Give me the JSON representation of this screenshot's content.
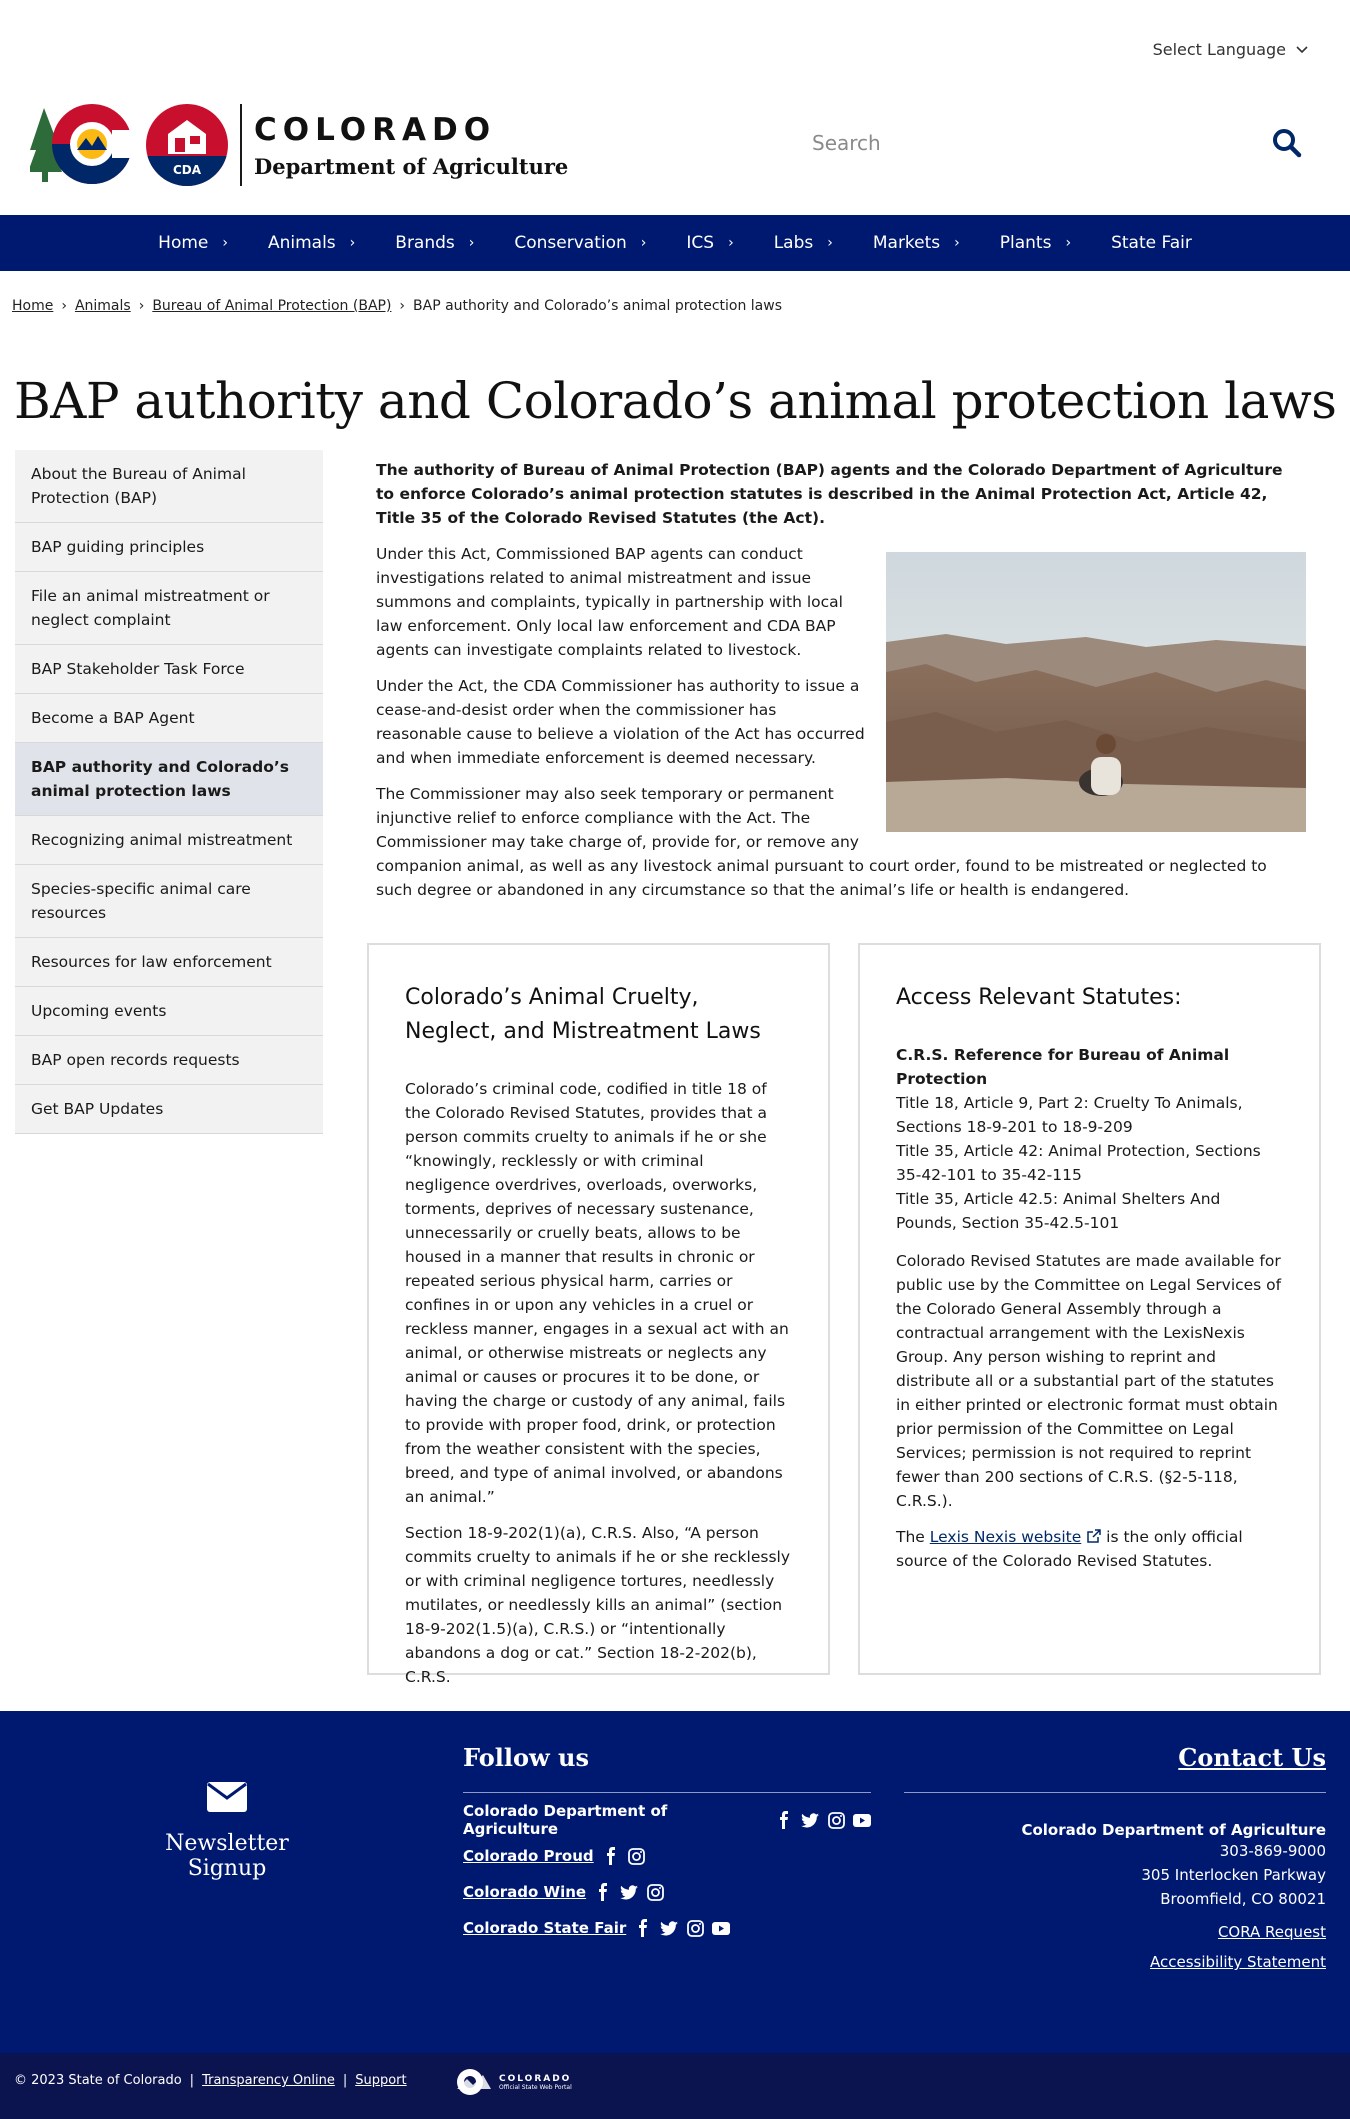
{
  "header": {
    "language": "Select Language",
    "logo_title": "COLORADO",
    "logo_subtitle": "Department of Agriculture",
    "logo_badge": "CDA",
    "search_placeholder": "Search"
  },
  "nav": [
    "Home",
    "Animals",
    "Brands",
    "Conservation",
    "ICS",
    "Labs",
    "Markets",
    "Plants",
    "State Fair"
  ],
  "breadcrumb": {
    "items": [
      "Home",
      "Animals",
      "Bureau of Animal Protection (BAP)"
    ],
    "current": "BAP authority and Colorado’s animal protection laws"
  },
  "page_title": "BAP authority and Colorado’s animal protection laws",
  "sidebar": {
    "items": [
      "About the Bureau of Animal Protection (BAP)",
      "BAP guiding principles",
      "File an animal mistreatment or neglect complaint",
      "BAP Stakeholder Task Force",
      "Become a BAP Agent",
      "BAP authority and Colorado’s animal protection laws",
      "Recognizing animal mistreatment",
      "Species-specific animal care resources",
      "Resources for law enforcement",
      "Upcoming events",
      "BAP open records requests",
      "Get BAP Updates"
    ],
    "active_index": 5
  },
  "main": {
    "intro": "The authority of Bureau of Animal Protection (BAP) agents and the Colorado Department of Agriculture to enforce Colorado’s animal protection statutes is described in the Animal Protection Act, Article 42, Title 35 of the Colorado Revised Statutes (the Act).",
    "p1": "Under this Act, Commissioned BAP agents can conduct investigations related to animal mistreatment and issue summons and complaints, typically in partnership with local law enforcement. Only local law enforcement and CDA BAP agents can investigate complaints related to livestock.",
    "p2": "Under the Act, the CDA Commissioner has authority to issue a cease-and-desist order when the commissioner has reasonable cause to believe a violation of the Act  has occurred and when immediate enforcement is deemed necessary.",
    "p3": "The Commissioner may also seek temporary or permanent injunctive relief to enforce compliance with the Act. The Commissioner may take charge of, provide for, or remove any companion animal, as well as any livestock animal pursuant to court order, found to be mistreated or neglected to such degree or abandoned in any circumstance so that the animal’s life or health is endangered."
  },
  "card_left": {
    "title": "Colorado’s Animal Cruelty, Neglect, and Mistreatment Laws",
    "p1": "Colorado’s criminal code, codified in title 18 of the Colorado Revised Statutes, provides that a person commits cruelty to animals if he or she  “knowingly, recklessly or with criminal negligence overdrives, overloads, overworks, torments, deprives of necessary sustenance, unnecessarily or cruelly beats, allows to be housed in a manner that results in chronic or repeated serious physical harm, carries or confines in or upon any vehicles in a cruel or reckless manner, engages in a sexual act with an animal, or otherwise mistreats or neglects any animal or causes or procures it to be done, or having the charge or custody of any animal, fails to provide with proper food, drink, or protection from the weather consistent with the species, breed, and type of animal involved, or abandons an animal.”",
    "p2": "Section 18-9-202(1)(a), C.R.S. Also, “A person commits cruelty to animals if he or she recklessly or with criminal negligence tortures, needlessly mutilates, or needlessly kills an animal” (section 18-9-202(1.5)(a), C.R.S.) or “intentionally abandons a dog or cat.” Section 18-2-202(b), C.R.S."
  },
  "card_right": {
    "title": "Access Relevant Statutes:",
    "ref_heading": "C.R.S. Reference for Bureau of Animal Protection",
    "ref_lines": [
      "Title 18, Article 9, Part 2: Cruelty To Animals, Sections 18-9-201 to 18-9-209",
      "Title 35, Article 42: Animal Protection, Sections 35-42-101 to 35-42-115",
      "Title 35, Article 42.5: Animal Shelters And Pounds, Section 35-42.5-101"
    ],
    "p1": "Colorado Revised Statutes are made available for public use by the Committee on Legal Services of the Colorado General Assembly through a contractual arrangement with the LexisNexis Group. Any person wishing to reprint and distribute all or a substantial part of the statutes in either printed or electronic format must obtain prior permission of the Committee on Legal Services; permission is not required to reprint fewer than 200 sections of C.R.S. (§2-5-118, C.R.S.).",
    "p2_pre": "The ",
    "p2_link": "Lexis Nexis website",
    "p2_post": " is the only official source of the Colorado Revised Statutes."
  },
  "footer": {
    "newsletter": "Newsletter Signup",
    "follow_title": "Follow us",
    "social": [
      {
        "label": "Colorado Department of Agriculture",
        "icons": [
          "facebook-icon",
          "twitter-icon",
          "instagram-icon",
          "youtube-icon"
        ]
      },
      {
        "label": "Colorado Proud",
        "icons": [
          "facebook-icon",
          "instagram-icon"
        ]
      },
      {
        "label": "Colorado Wine",
        "icons": [
          "facebook-icon",
          "twitter-icon",
          "instagram-icon"
        ]
      },
      {
        "label": "Colorado State Fair",
        "icons": [
          "facebook-icon",
          "twitter-icon",
          "instagram-icon",
          "youtube-icon"
        ]
      }
    ],
    "contact_title": "Contact Us",
    "contact_org": "Colorado Department of Agriculture",
    "contact_phone": "303-869-9000",
    "contact_street": "305 Interlocken Parkway",
    "contact_city": "Broomfield, CO 80021",
    "cora": "CORA Request",
    "accessibility": "Accessibility Statement",
    "copyright": "© 2023 State of Colorado",
    "sep": "|",
    "transparency": "Transparency Online",
    "support": "Support",
    "state_logo_title": "COLORADO",
    "state_logo_sub": "Official State Web Portal"
  },
  "colors": {
    "nav": "#001970",
    "footer": "#001970",
    "footer_bottom": "#0c1450",
    "accent": "#002868"
  }
}
